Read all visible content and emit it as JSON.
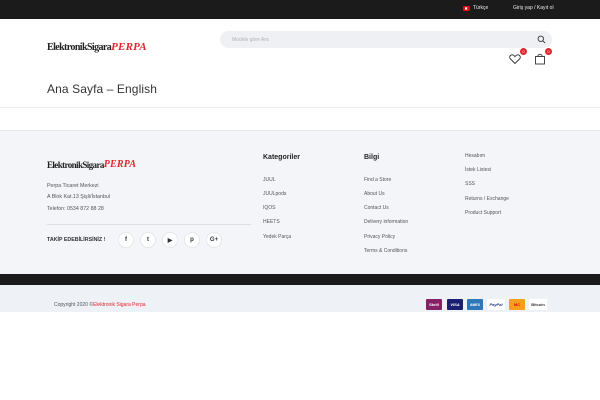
{
  "topbar": {
    "language": "Türkçe",
    "login": "Giriş yap / Kayıt ol"
  },
  "logo": {
    "part1": "ElektronikSigara",
    "part2": "PERPA"
  },
  "search": {
    "placeholder": "Modele göre Ara"
  },
  "header": {
    "wishlist_count": "0",
    "cart_count": "0"
  },
  "page": {
    "title": "Ana Sayfa – English"
  },
  "footer": {
    "address": [
      "Perpa Ticaret Merkezi",
      "A Blok Kat.13 Şişli/İstanbul",
      "Telefon: 0534 872 88 28"
    ],
    "follow": "TAKİP EDEBİLİRSİNİZ !",
    "social": [
      {
        "name": "facebook",
        "glyph": "f"
      },
      {
        "name": "twitter",
        "glyph": "t"
      },
      {
        "name": "youtube",
        "glyph": "▶"
      },
      {
        "name": "pinterest",
        "glyph": "p"
      },
      {
        "name": "google-plus",
        "glyph": "G+"
      }
    ],
    "columns": [
      {
        "title": "Kategoriler",
        "links": [
          "JUUL",
          "JUULpods",
          "IQOS",
          "HEETS",
          "Yedek Parça"
        ]
      },
      {
        "title": "Bilgi",
        "links": [
          "Find a Store",
          "About Us",
          "Contact Us",
          "Delivery information",
          "Privacy Policy",
          "Terms & Conditions"
        ]
      },
      {
        "title": "",
        "links": [
          "Hesabım",
          "İstek Listesi",
          "SSS",
          "Returns / Exchange",
          "Product Support"
        ]
      }
    ]
  },
  "bottom": {
    "copyright_prefix": "Copyright 2020 ©",
    "copyright_brand": "Elektronik Sigara Perpa",
    "payments": [
      {
        "name": "Skrill",
        "color": "#862165",
        "text_color": "#ffffff"
      },
      {
        "name": "VISA",
        "color": "#1a1f71",
        "text_color": "#ffffff"
      },
      {
        "name": "AMEX",
        "color": "#2e77bb",
        "text_color": "#ffffff"
      },
      {
        "name": "PayPal",
        "color": "#ffffff",
        "text_color": "#253b80"
      },
      {
        "name": "MC",
        "color": "#f79e1b",
        "text_color": "#eb001b"
      },
      {
        "name": "Bitcoin",
        "color": "#ffffff",
        "text_color": "#333333"
      }
    ]
  },
  "colors": {
    "accent": "#e0262c",
    "topbar": "#1b1b1b",
    "footer_bg": "#f3f5f9"
  }
}
